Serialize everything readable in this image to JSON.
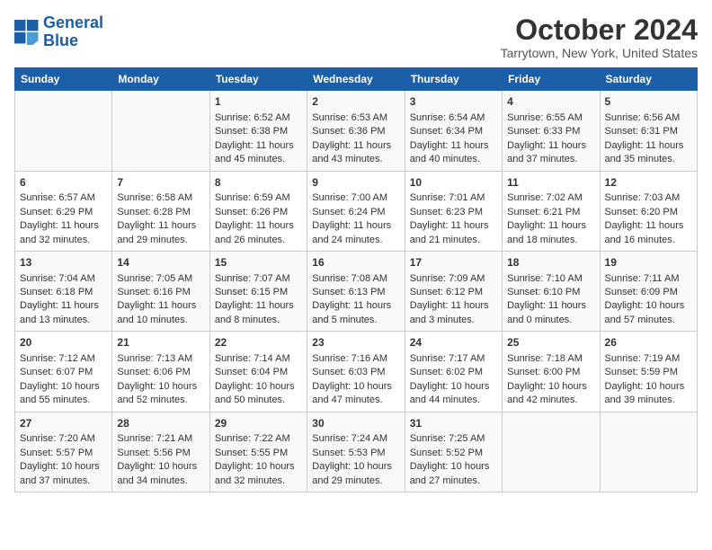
{
  "header": {
    "logo_line1": "General",
    "logo_line2": "Blue",
    "title": "October 2024",
    "subtitle": "Tarrytown, New York, United States"
  },
  "days_of_week": [
    "Sunday",
    "Monday",
    "Tuesday",
    "Wednesday",
    "Thursday",
    "Friday",
    "Saturday"
  ],
  "weeks": [
    [
      {
        "num": "",
        "sunrise": "",
        "sunset": "",
        "daylight": ""
      },
      {
        "num": "",
        "sunrise": "",
        "sunset": "",
        "daylight": ""
      },
      {
        "num": "1",
        "sunrise": "Sunrise: 6:52 AM",
        "sunset": "Sunset: 6:38 PM",
        "daylight": "Daylight: 11 hours and 45 minutes."
      },
      {
        "num": "2",
        "sunrise": "Sunrise: 6:53 AM",
        "sunset": "Sunset: 6:36 PM",
        "daylight": "Daylight: 11 hours and 43 minutes."
      },
      {
        "num": "3",
        "sunrise": "Sunrise: 6:54 AM",
        "sunset": "Sunset: 6:34 PM",
        "daylight": "Daylight: 11 hours and 40 minutes."
      },
      {
        "num": "4",
        "sunrise": "Sunrise: 6:55 AM",
        "sunset": "Sunset: 6:33 PM",
        "daylight": "Daylight: 11 hours and 37 minutes."
      },
      {
        "num": "5",
        "sunrise": "Sunrise: 6:56 AM",
        "sunset": "Sunset: 6:31 PM",
        "daylight": "Daylight: 11 hours and 35 minutes."
      }
    ],
    [
      {
        "num": "6",
        "sunrise": "Sunrise: 6:57 AM",
        "sunset": "Sunset: 6:29 PM",
        "daylight": "Daylight: 11 hours and 32 minutes."
      },
      {
        "num": "7",
        "sunrise": "Sunrise: 6:58 AM",
        "sunset": "Sunset: 6:28 PM",
        "daylight": "Daylight: 11 hours and 29 minutes."
      },
      {
        "num": "8",
        "sunrise": "Sunrise: 6:59 AM",
        "sunset": "Sunset: 6:26 PM",
        "daylight": "Daylight: 11 hours and 26 minutes."
      },
      {
        "num": "9",
        "sunrise": "Sunrise: 7:00 AM",
        "sunset": "Sunset: 6:24 PM",
        "daylight": "Daylight: 11 hours and 24 minutes."
      },
      {
        "num": "10",
        "sunrise": "Sunrise: 7:01 AM",
        "sunset": "Sunset: 6:23 PM",
        "daylight": "Daylight: 11 hours and 21 minutes."
      },
      {
        "num": "11",
        "sunrise": "Sunrise: 7:02 AM",
        "sunset": "Sunset: 6:21 PM",
        "daylight": "Daylight: 11 hours and 18 minutes."
      },
      {
        "num": "12",
        "sunrise": "Sunrise: 7:03 AM",
        "sunset": "Sunset: 6:20 PM",
        "daylight": "Daylight: 11 hours and 16 minutes."
      }
    ],
    [
      {
        "num": "13",
        "sunrise": "Sunrise: 7:04 AM",
        "sunset": "Sunset: 6:18 PM",
        "daylight": "Daylight: 11 hours and 13 minutes."
      },
      {
        "num": "14",
        "sunrise": "Sunrise: 7:05 AM",
        "sunset": "Sunset: 6:16 PM",
        "daylight": "Daylight: 11 hours and 10 minutes."
      },
      {
        "num": "15",
        "sunrise": "Sunrise: 7:07 AM",
        "sunset": "Sunset: 6:15 PM",
        "daylight": "Daylight: 11 hours and 8 minutes."
      },
      {
        "num": "16",
        "sunrise": "Sunrise: 7:08 AM",
        "sunset": "Sunset: 6:13 PM",
        "daylight": "Daylight: 11 hours and 5 minutes."
      },
      {
        "num": "17",
        "sunrise": "Sunrise: 7:09 AM",
        "sunset": "Sunset: 6:12 PM",
        "daylight": "Daylight: 11 hours and 3 minutes."
      },
      {
        "num": "18",
        "sunrise": "Sunrise: 7:10 AM",
        "sunset": "Sunset: 6:10 PM",
        "daylight": "Daylight: 11 hours and 0 minutes."
      },
      {
        "num": "19",
        "sunrise": "Sunrise: 7:11 AM",
        "sunset": "Sunset: 6:09 PM",
        "daylight": "Daylight: 10 hours and 57 minutes."
      }
    ],
    [
      {
        "num": "20",
        "sunrise": "Sunrise: 7:12 AM",
        "sunset": "Sunset: 6:07 PM",
        "daylight": "Daylight: 10 hours and 55 minutes."
      },
      {
        "num": "21",
        "sunrise": "Sunrise: 7:13 AM",
        "sunset": "Sunset: 6:06 PM",
        "daylight": "Daylight: 10 hours and 52 minutes."
      },
      {
        "num": "22",
        "sunrise": "Sunrise: 7:14 AM",
        "sunset": "Sunset: 6:04 PM",
        "daylight": "Daylight: 10 hours and 50 minutes."
      },
      {
        "num": "23",
        "sunrise": "Sunrise: 7:16 AM",
        "sunset": "Sunset: 6:03 PM",
        "daylight": "Daylight: 10 hours and 47 minutes."
      },
      {
        "num": "24",
        "sunrise": "Sunrise: 7:17 AM",
        "sunset": "Sunset: 6:02 PM",
        "daylight": "Daylight: 10 hours and 44 minutes."
      },
      {
        "num": "25",
        "sunrise": "Sunrise: 7:18 AM",
        "sunset": "Sunset: 6:00 PM",
        "daylight": "Daylight: 10 hours and 42 minutes."
      },
      {
        "num": "26",
        "sunrise": "Sunrise: 7:19 AM",
        "sunset": "Sunset: 5:59 PM",
        "daylight": "Daylight: 10 hours and 39 minutes."
      }
    ],
    [
      {
        "num": "27",
        "sunrise": "Sunrise: 7:20 AM",
        "sunset": "Sunset: 5:57 PM",
        "daylight": "Daylight: 10 hours and 37 minutes."
      },
      {
        "num": "28",
        "sunrise": "Sunrise: 7:21 AM",
        "sunset": "Sunset: 5:56 PM",
        "daylight": "Daylight: 10 hours and 34 minutes."
      },
      {
        "num": "29",
        "sunrise": "Sunrise: 7:22 AM",
        "sunset": "Sunset: 5:55 PM",
        "daylight": "Daylight: 10 hours and 32 minutes."
      },
      {
        "num": "30",
        "sunrise": "Sunrise: 7:24 AM",
        "sunset": "Sunset: 5:53 PM",
        "daylight": "Daylight: 10 hours and 29 minutes."
      },
      {
        "num": "31",
        "sunrise": "Sunrise: 7:25 AM",
        "sunset": "Sunset: 5:52 PM",
        "daylight": "Daylight: 10 hours and 27 minutes."
      },
      {
        "num": "",
        "sunrise": "",
        "sunset": "",
        "daylight": ""
      },
      {
        "num": "",
        "sunrise": "",
        "sunset": "",
        "daylight": ""
      }
    ]
  ]
}
